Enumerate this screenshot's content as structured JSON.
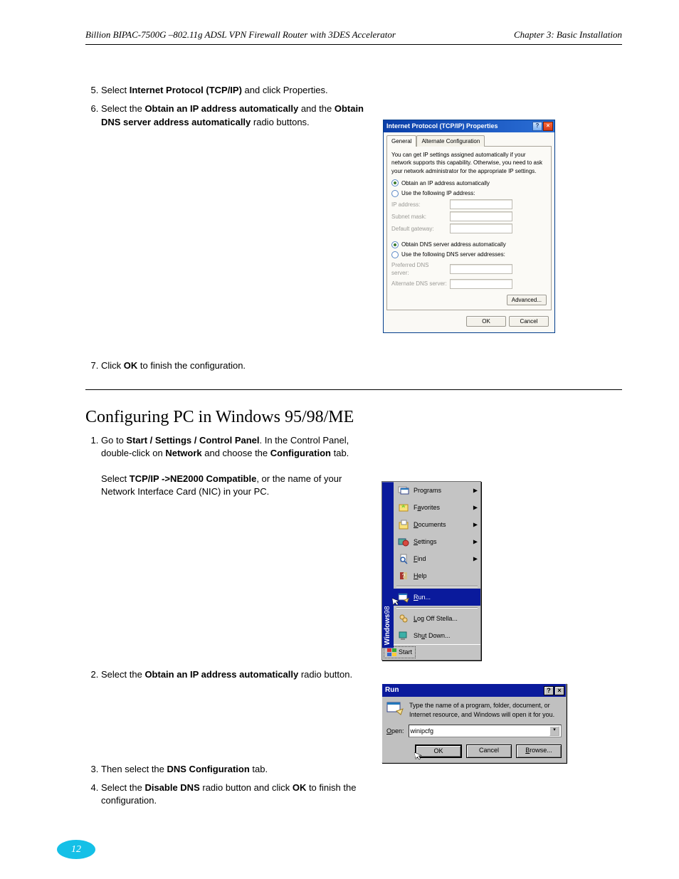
{
  "header": {
    "product_line": "Billion BIPAC-7500G  –802.11g ADSL VPN Firewall Router with 3DES Accelerator",
    "chapter": "Chapter 3: Basic Installation"
  },
  "section1": {
    "steps": [
      "Select <b>Internet Protocol (TCP/IP)</b> and click Properties.",
      "Select the <b>Obtain an IP address automatically</b> and the <b>Obtain DNS server address automatically</b> radio buttons."
    ],
    "step7": "Click <b>OK</b> to finish the configuration."
  },
  "dialog_tcpip": {
    "title": "Internet Protocol (TCP/IP) Properties",
    "tabs": {
      "general": "General",
      "alt": "Alternate Configuration"
    },
    "intro": "You can get IP settings assigned automatically if your network supports this capability. Otherwise, you need to ask your network administrator for the appropriate IP settings.",
    "radio": {
      "ip_auto": "Obtain an IP address automatically",
      "ip_manual": "Use the following IP address:",
      "dns_auto": "Obtain DNS server address automatically",
      "dns_manual": "Use the following DNS server addresses:"
    },
    "labels": {
      "ip": "IP address:",
      "subnet": "Subnet mask:",
      "gateway": "Default gateway:",
      "dns1": "Preferred DNS server:",
      "dns2": "Alternate DNS server:"
    },
    "buttons": {
      "advanced": "Advanced...",
      "ok": "OK",
      "cancel": "Cancel"
    }
  },
  "section2": {
    "title": "Configuring PC in Windows 95/98/ME",
    "step1_lead": "Go to <b>Start / Settings / Control Panel</b>. In the Control Panel, double-click on <b>Network</b> and choose the Configuration tab.",
    "step1_a": "Select <b>TCP/IP ->NE2000 Compatible</b>, or the name of your Network Interface Card (NIC) in your PC.",
    "step2": "Select the <b>Obtain an IP address automatically</b> radio button.",
    "step3": "Then select the <b>DNS Configuration</b> tab.",
    "step4": "Select the <b>Disable DNS</b> radio button and click <b>OK</b> to finish the configuration."
  },
  "startmenu": {
    "brand_bold": "Windows",
    "brand_thin": "98",
    "items": [
      {
        "label": "Programs",
        "icon": "programs",
        "arrow": true
      },
      {
        "label": "Favorites",
        "icon": "favorites",
        "arrow": true
      },
      {
        "label": "Documents",
        "icon": "documents",
        "arrow": true
      },
      {
        "label": "Settings",
        "icon": "settings",
        "arrow": true
      },
      {
        "label": "Find",
        "icon": "find",
        "arrow": true
      },
      {
        "label": "Help",
        "icon": "help",
        "arrow": false
      }
    ],
    "run": "Run...",
    "logoff": "Log Off Stella...",
    "shutdown": "Shut Down...",
    "start": "Start"
  },
  "rundlg": {
    "title": "Run",
    "intro": "Type the name of a program, folder, document, or Internet resource, and Windows will open it for you.",
    "open_label": "Open:",
    "open_value": "winipcfg",
    "buttons": {
      "ok": "OK",
      "cancel": "Cancel",
      "browse": "Browse..."
    }
  },
  "footer": {
    "page": "12"
  }
}
